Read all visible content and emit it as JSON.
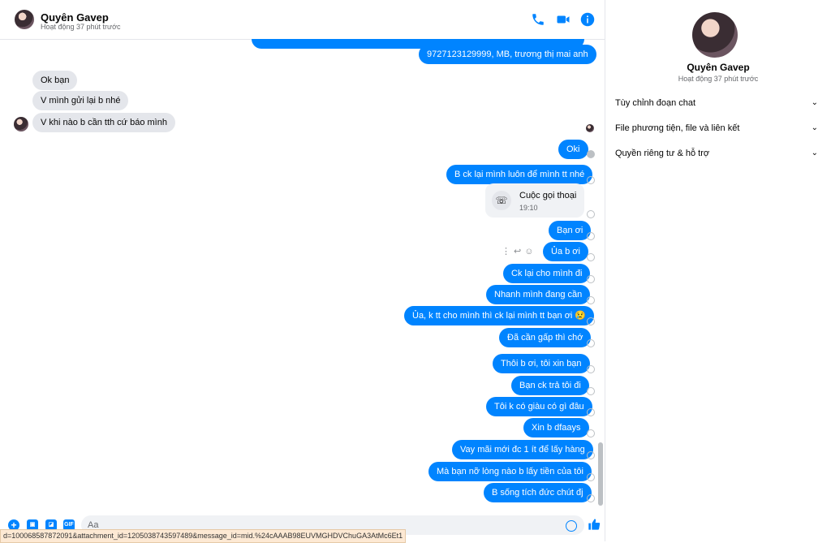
{
  "header": {
    "name": "Quyên Gavep",
    "status": "Hoạt động 37 phút trước",
    "icons": [
      "phone-icon",
      "video-icon",
      "info-icon"
    ]
  },
  "messages": [
    {
      "side": "out",
      "text": "9727123129999, MB, trương thị mai anh"
    },
    {
      "side": "in",
      "text": "Ok bạn"
    },
    {
      "side": "in",
      "text": "V mình gửi lại b nhé"
    },
    {
      "side": "in",
      "text": "V khi nào b cần tth cứ báo mình"
    },
    {
      "side": "out",
      "text": "Oki"
    },
    {
      "side": "out",
      "text": "B ck lại mình luôn để mình tt nhé"
    },
    {
      "side": "out",
      "text": "Bạn ơi"
    },
    {
      "side": "out",
      "text": "Ủa b ơi"
    },
    {
      "side": "out",
      "text": "Ck lại cho mình đi"
    },
    {
      "side": "out",
      "text": "Nhanh mình đang cần"
    },
    {
      "side": "out",
      "text": "Ủa, k tt cho mình thì ck lại mình tt bạn ơi 😢"
    },
    {
      "side": "out",
      "text": "Đã cần gấp thì chớ"
    },
    {
      "side": "out",
      "text": "Thôi b ơi, tôi xin bạn"
    },
    {
      "side": "out",
      "text": "Bạn ck trả tôi đi"
    },
    {
      "side": "out",
      "text": "Tôi k có giàu có gì đâu"
    },
    {
      "side": "out",
      "text": "Xin b dfaays"
    },
    {
      "side": "out",
      "text": "Vay mãi mới đc 1 ít để lấy hàng"
    },
    {
      "side": "out",
      "text": "Mà bạn nỡ lòng nào b lấy tiền của tôi"
    },
    {
      "side": "out",
      "text": "B sống tích đức chút đj"
    }
  ],
  "call": {
    "title": "Cuộc gọi thoại",
    "time": "19:10"
  },
  "composer": {
    "placeholder": "Aa",
    "icons": [
      "plus-icon",
      "image-icon",
      "sticker-icon",
      "gif-icon"
    ],
    "gif_label": "GIF"
  },
  "status_bar": {
    "url": "d=100068587872091&attachment_id=1205038743597489&message_id=mid.%24cAAAB98EUVMGHDVChuGA3AtMc6Et1"
  },
  "panel": {
    "name": "Quyên Gavep",
    "status": "Hoạt động 37 phút trước",
    "items": [
      {
        "label": "Tùy chỉnh đoạn chat"
      },
      {
        "label": "File phương tiện, file và liên kết"
      },
      {
        "label": "Quyền riêng tư & hỗ trợ"
      }
    ]
  },
  "colors": {
    "accent": "#0084ff",
    "incoming_bubble": "#e4e6eb",
    "secondary_text": "#65676b"
  }
}
